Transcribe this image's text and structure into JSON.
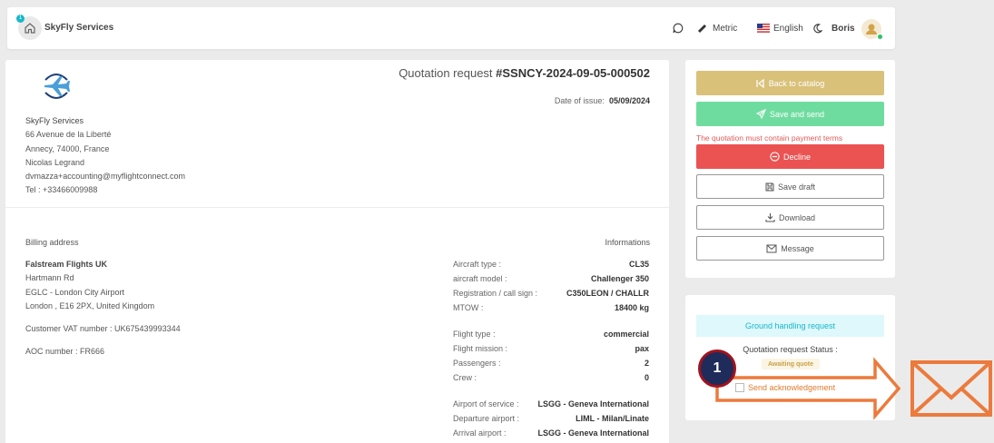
{
  "header": {
    "notification_count": "1",
    "brand": "SkyFly Services",
    "units": "Metric",
    "language": "English",
    "user": "Boris"
  },
  "quote": {
    "title_prefix": "Quotation request ",
    "number": "#SSNCY-2024-09-05-000502",
    "date_label": "Date of issue:",
    "date_value": "05/09/2024"
  },
  "sender": {
    "name": "SkyFly Services",
    "street": "66 Avenue de la Liberté",
    "city": "Annecy,  74000,  France",
    "contact": "Nicolas Legrand",
    "email": "dvmazza+accounting@myflightconnect.com",
    "tel": "Tel : +33466009988"
  },
  "billing": {
    "title": "Billing address",
    "company": "Falstream Flights UK",
    "line1": "Hartmann Rd",
    "line2": "EGLC - London City Airport",
    "line3": "London ,  E16 2PX,  United Kingdom",
    "vat": "Customer VAT number : UK675439993344",
    "aoc": "AOC number : FR666"
  },
  "informations": {
    "title": "Informations",
    "rows": [
      {
        "label": "Aircraft type :",
        "value": "CL35"
      },
      {
        "label": "aircraft model :",
        "value": "Challenger 350"
      },
      {
        "label": "Registration / call sign :",
        "value": "C350LEON / CHALLR"
      },
      {
        "label": "MTOW :",
        "value": "18400 kg"
      },
      {
        "label": "Flight type :",
        "value": "commercial"
      },
      {
        "label": "Flight mission :",
        "value": "pax"
      },
      {
        "label": "Passengers :",
        "value": "2"
      },
      {
        "label": "Crew :",
        "value": "0"
      },
      {
        "label": "Airport of service :",
        "value": "LSGG - Geneva International"
      },
      {
        "label": "Departure airport :",
        "value": "LIML - Milan/Linate"
      },
      {
        "label": "Arrival airport :",
        "value": "LSGG - Geneva International"
      }
    ]
  },
  "actions": {
    "back": "Back to catalog",
    "save_send": "Save and send",
    "warning": "The quotation must contain payment terms",
    "decline": "Decline",
    "save_draft": "Save draft",
    "download": "Download",
    "message": "Message"
  },
  "status": {
    "request_type": "Ground handling request",
    "label": "Quotation request Status :",
    "badge": "Awaiting quote",
    "ack": "Send acknowledgement"
  },
  "annotation": {
    "step": "1"
  },
  "colors": {
    "accent": "#18b7c9",
    "gold": "#d9c17a",
    "green": "#6fdc9f",
    "red": "#eb5353",
    "annotation_orange": "#ec7a3c",
    "annotation_navy": "#1f2b5a"
  }
}
